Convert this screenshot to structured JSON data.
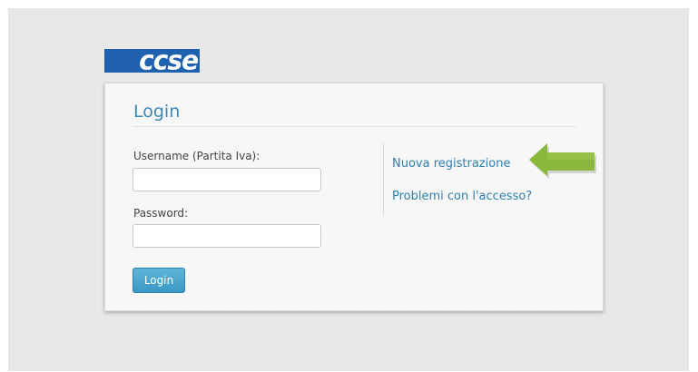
{
  "logo": {
    "text": "ccse"
  },
  "login": {
    "title": "Login",
    "username_label": "Username (Partita Iva):",
    "username_value": "",
    "password_label": "Password:",
    "password_value": "",
    "submit_label": "Login"
  },
  "links": {
    "register": "Nuova registrazione",
    "access_problems": "Problemi con l'accesso?"
  },
  "colors": {
    "accent": "#3b87b5",
    "logo_bg": "#1f61ad",
    "button": "#3a98c4",
    "arrow": "#8ab83c"
  },
  "icons": {
    "arrow": "left-arrow-icon"
  }
}
